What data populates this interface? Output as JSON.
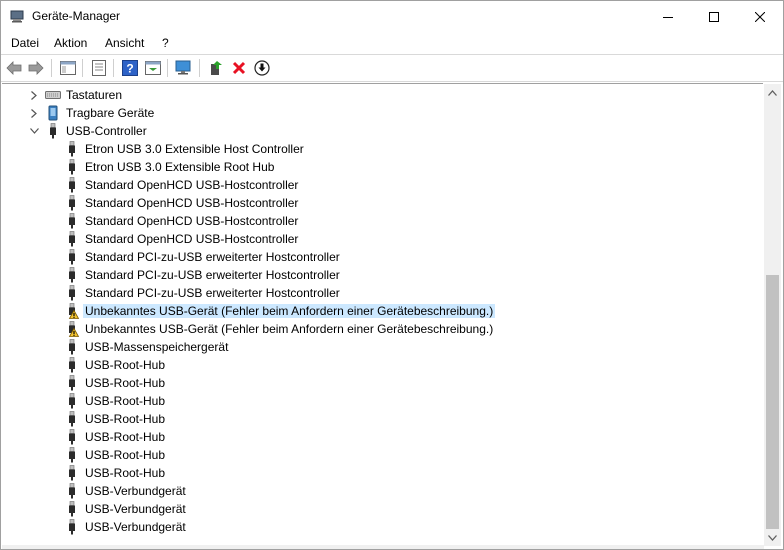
{
  "window": {
    "title": "Geräte-Manager"
  },
  "menu": [
    "Datei",
    "Aktion",
    "Ansicht",
    "?"
  ],
  "toolbar": [
    "back-arrow-icon",
    "forward-arrow-icon",
    "properties-icon",
    "list-view-icon",
    "help-icon",
    "action-icon",
    "monitor-scan-icon",
    "update-driver-icon",
    "uninstall-x-icon",
    "download-icon"
  ],
  "tree": {
    "categories": [
      {
        "label": "Tastaturen",
        "expanded": false,
        "icon": "keyboard-icon"
      },
      {
        "label": "Tragbare Geräte",
        "expanded": false,
        "icon": "portable-device-icon"
      },
      {
        "label": "USB-Controller",
        "expanded": true,
        "icon": "usb-icon"
      }
    ],
    "usb_devices": [
      {
        "label": "Etron USB 3.0 Extensible Host Controller",
        "warning": false
      },
      {
        "label": "Etron USB 3.0 Extensible Root Hub",
        "warning": false
      },
      {
        "label": "Standard OpenHCD USB-Hostcontroller",
        "warning": false
      },
      {
        "label": "Standard OpenHCD USB-Hostcontroller",
        "warning": false
      },
      {
        "label": "Standard OpenHCD USB-Hostcontroller",
        "warning": false
      },
      {
        "label": "Standard OpenHCD USB-Hostcontroller",
        "warning": false
      },
      {
        "label": "Standard PCI-zu-USB erweiterter Hostcontroller",
        "warning": false
      },
      {
        "label": "Standard PCI-zu-USB erweiterter Hostcontroller",
        "warning": false
      },
      {
        "label": "Standard PCI-zu-USB erweiterter Hostcontroller",
        "warning": false
      },
      {
        "label": "Unbekanntes USB-Gerät (Fehler beim Anfordern einer Gerätebeschreibung.)",
        "warning": true,
        "selected": true
      },
      {
        "label": "Unbekanntes USB-Gerät (Fehler beim Anfordern einer Gerätebeschreibung.)",
        "warning": true
      },
      {
        "label": "USB-Massenspeichergerät",
        "warning": false
      },
      {
        "label": "USB-Root-Hub",
        "warning": false
      },
      {
        "label": "USB-Root-Hub",
        "warning": false
      },
      {
        "label": "USB-Root-Hub",
        "warning": false
      },
      {
        "label": "USB-Root-Hub",
        "warning": false
      },
      {
        "label": "USB-Root-Hub",
        "warning": false
      },
      {
        "label": "USB-Root-Hub",
        "warning": false
      },
      {
        "label": "USB-Root-Hub",
        "warning": false
      },
      {
        "label": "USB-Verbundgerät",
        "warning": false
      },
      {
        "label": "USB-Verbundgerät",
        "warning": false
      },
      {
        "label": "USB-Verbundgerät",
        "warning": false
      }
    ]
  },
  "colors": {
    "selection": "#cce8ff",
    "warning": "#f4c430",
    "uninstall": "#e81123"
  }
}
